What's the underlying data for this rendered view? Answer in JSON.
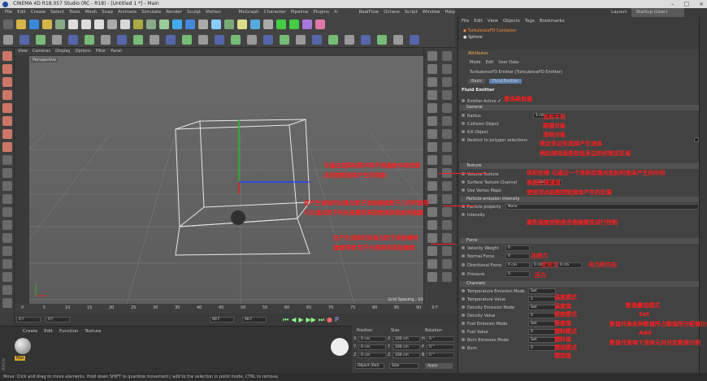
{
  "title": "CINEMA 4D R18.057 Studio (RC - R18) - [Untitled 1 *] - Main",
  "menus": [
    "File",
    "Edit",
    "Create",
    "Select",
    "Tools",
    "Mesh",
    "Snap",
    "Animate",
    "Simulate",
    "Render",
    "Sculpt",
    "Motion Tracker",
    "MoGraph",
    "Character",
    "Pipeline",
    "Plugins",
    "X-Particles",
    "RealFlow",
    "Octane",
    "Script",
    "Window",
    "Help"
  ],
  "layout": {
    "label": "Layout:",
    "value": "Startup (User)"
  },
  "viewport": {
    "menus": [
      "View",
      "Cameras",
      "Display",
      "Options",
      "Filter",
      "Panel"
    ],
    "label": "Perspective",
    "grid_spacing": "Grid Spacing : 100 cm"
  },
  "timeline": {
    "ticks": [
      "0",
      "5",
      "10",
      "15",
      "20",
      "25",
      "30",
      "35",
      "40",
      "45",
      "50",
      "55",
      "60",
      "65",
      "70",
      "75",
      "80",
      "85",
      "90"
    ],
    "end": "0 F",
    "start_field": "0 F",
    "cur_field": "0 F",
    "max_field": "90 F",
    "max2_field": "90 F"
  },
  "materials": {
    "menus": [
      "Create",
      "Edit",
      "Function",
      "Texture"
    ],
    "item": "Mat"
  },
  "coords": {
    "headers": [
      "Position",
      "Size",
      "Rotation"
    ],
    "rows": [
      {
        "a": "X",
        "v1": "0 cm",
        "b": "X",
        "v2": "100 cm",
        "c": "H",
        "v3": "0 °"
      },
      {
        "a": "Y",
        "v1": "0 cm",
        "b": "Y",
        "v2": "100 cm",
        "c": "P",
        "v3": "0 °"
      },
      {
        "a": "Z",
        "v1": "0 cm",
        "b": "Z",
        "v2": "100 cm",
        "c": "B",
        "v3": "0 °"
      }
    ],
    "mode1": "Object (Rel)",
    "mode2": "Size",
    "apply": "Apply"
  },
  "objects": {
    "menus": [
      "File",
      "Edit",
      "View",
      "Objects",
      "Tags",
      "Bookmarks"
    ],
    "items": [
      "TurbulenceFD Container",
      "Sphere"
    ]
  },
  "attributes": {
    "header": "Attributes",
    "menus": [
      "Mode",
      "Edit",
      "User Data"
    ],
    "object_name": "TurbulenceFD Emitter [TurbulenceFD Emitter]",
    "tabs": [
      "Basic",
      "Fluid Emitter"
    ],
    "section_title": "Fluid Emitter",
    "emitter_active": "Emitter Active",
    "general": "General",
    "radius": {
      "label": "Radius",
      "value": "1 cm"
    },
    "collision": "Collision Object",
    "kill": "Kill Object",
    "restrict": "Restrict to polygon selections",
    "texture": "Texture",
    "volume_texture": "Volume Texture",
    "surface_channel": {
      "label": "Surface Texture Channel",
      "value": "Color"
    },
    "use_vertex": "Use Vertex Maps",
    "particle": "Particle emission intensity",
    "particle_property": {
      "label": "Particle property",
      "value": "None"
    },
    "intensity": "Intensity",
    "force": "Force",
    "velocity_weight": "Velocity Weight",
    "normal_force": "Normal Force",
    "directional_force": {
      "label": "Directional Force",
      "v1": "0 cm",
      "v2": "0 cm",
      "v3": "0 cm"
    },
    "pressure": {
      "label": "Pressure",
      "value": "0"
    },
    "normal_value": "0",
    "velocity_value": "0",
    "channels": "Channels",
    "ch_rows": [
      {
        "label": "Temperature Emission Mode",
        "value": "Set"
      },
      {
        "label": "Temperature Value",
        "value": "1"
      },
      {
        "label": "Density Emission Mode",
        "value": "Set"
      },
      {
        "label": "Density Value",
        "value": "0"
      },
      {
        "label": "Fuel Emission Mode",
        "value": "Set"
      },
      {
        "label": "Fuel Value",
        "value": "0"
      },
      {
        "label": "Burn Emission Mode",
        "value": "Set"
      },
      {
        "label": "Burn",
        "value": "0"
      }
    ]
  },
  "annotations": {
    "emitter_active": "激活发射器",
    "radius": "发射半径",
    "collision": "碰撞对象",
    "kill": "清除对象",
    "restrict1": "限定多边形选择产生流体",
    "restrict2": "例如球体面是较低多边形的限定区域",
    "vp1": "可通过选择材质中的不同通道中的纹理",
    "vp2": "达到控制流体产生的效果",
    "volume": "体积纹理 可通过一个体积纹理对发射的流体产生的作用",
    "surface": "表面纹理通道",
    "vertex": "使用顶点贴图控制流体产生的位置",
    "vp3": "在产生流体的对象为粒子发射器或粒子几何时使用",
    "vp4": "可以通过粒子的自身属性来控制流体发射的强度",
    "intensity": "属性强度控制是否根据属性进行控制",
    "vp5": "在产生流体的对象为粒子发射器时",
    "vp6": "速度倍增 粒子对流体的初始速度",
    "normal": "法线力",
    "directional": "定向力",
    "dir2": "向力的方向",
    "pressure": "压力",
    "temp": "温度模式",
    "temp_val": "温度值",
    "density": "密度模式",
    "density_val": "密度值",
    "fuel": "燃料模式",
    "fuel_val": "燃料值",
    "burn": "燃烧模式",
    "burn_val": "燃烧值",
    "right1": "数值叠加模式",
    "right2": "Set",
    "right3": "数值代表各种数值所占数值所分配值比例",
    "right4": "Add",
    "right5": "数值代表每个流体元对对应数值比例"
  },
  "status": "Move: Click and drag to move elements. Hold down SHIFT to quantize movement / add to the selection in point mode, CTRL to remove."
}
